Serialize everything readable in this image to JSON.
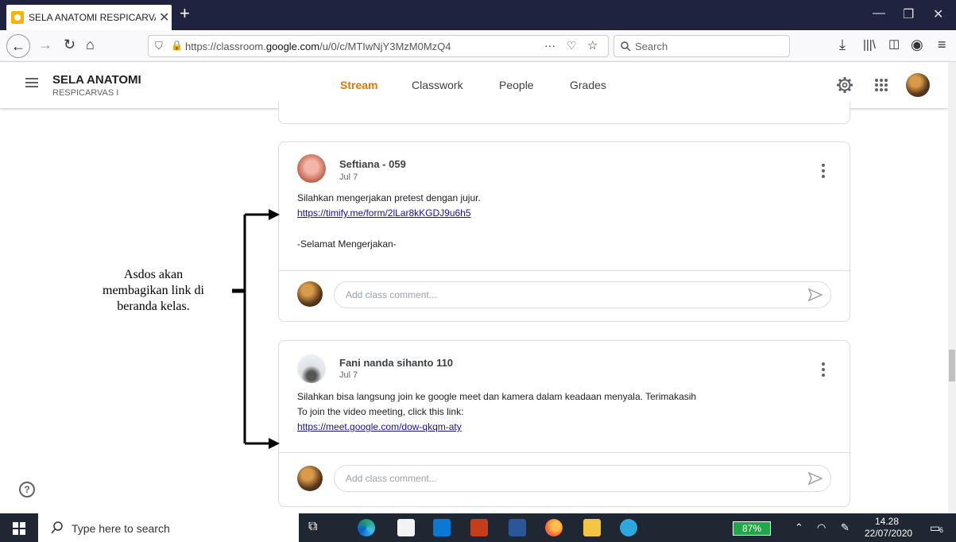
{
  "browser": {
    "tab_title": "SELA ANATOMI RESPICARVAS I",
    "tab_close": "✕",
    "new_tab": "+",
    "url_prefix": "https://classroom.",
    "url_domain": "google.com",
    "url_path": "/u/0/c/MTIwNjY3MzM0MzQ4",
    "url_more": "···",
    "search_placeholder": "Search"
  },
  "classroom": {
    "class_name": "SELA ANATOMI",
    "class_section": "RESPICARVAS I",
    "tabs": [
      "Stream",
      "Classwork",
      "People",
      "Grades"
    ]
  },
  "posts": [
    {
      "author": "Seftiana - 059",
      "date": "Jul 7",
      "line1": "Silahkan mengerjakan pretest dengan jujur.",
      "link": "https://timify.me/form/2lLar8kKGDJ9u6h5",
      "line3": "-Selamat Mengerjakan-",
      "comment_placeholder": "Add class comment..."
    },
    {
      "author": "Fani nanda sihanto 110",
      "date": "Jul 7",
      "line1": "Silahkan bisa langsung join ke google meet dan kamera dalam keadaan menyala. Terimakasih",
      "line2": "To join the video meeting, click this link:",
      "link": "https://meet.google.com/dow-qkqm-aty",
      "comment_placeholder": "Add class comment..."
    }
  ],
  "annotation": {
    "line1": "Asdos akan",
    "line2": "membagikan link di",
    "line3": "beranda kelas."
  },
  "help_glyph": "?",
  "taskbar": {
    "search_text": "Type here to search",
    "battery": "87%",
    "time": "14.28",
    "date": "22/07/2020",
    "notif_count": "6"
  },
  "colors": {
    "accent": "#e37400",
    "link": "#1a0dab",
    "tabbar": "#202340",
    "taskbar": "#1f2733"
  }
}
